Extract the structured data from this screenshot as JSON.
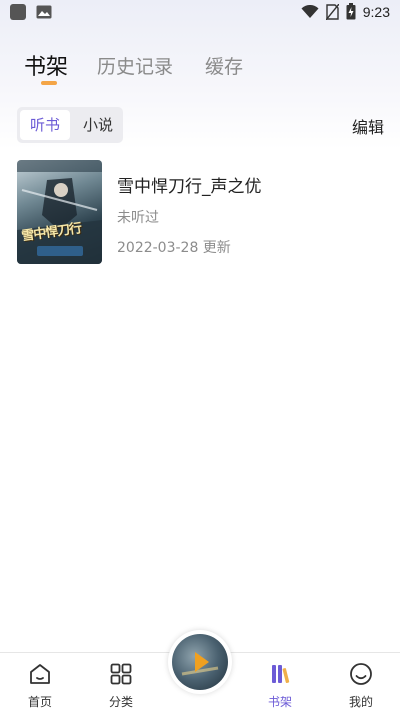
{
  "status_bar": {
    "time": "9:23",
    "icons": [
      "app-icon",
      "gallery-icon",
      "wifi-icon",
      "no-sim-icon",
      "battery-charging-icon"
    ]
  },
  "top_tabs": [
    {
      "label": "书架",
      "active": true
    },
    {
      "label": "历史记录",
      "active": false
    },
    {
      "label": "缓存",
      "active": false
    }
  ],
  "segment": {
    "items": [
      {
        "label": "听书",
        "active": true
      },
      {
        "label": "小说",
        "active": false
      }
    ]
  },
  "edit_label": "编辑",
  "books": [
    {
      "title": "雪中悍刀行_声之优",
      "status": "未听过",
      "updated": "2022-03-28 更新",
      "cover_text": "雪中悍刀行"
    }
  ],
  "bottom_nav": [
    {
      "label": "首页",
      "icon": "home-icon",
      "active": false
    },
    {
      "label": "分类",
      "icon": "category-icon",
      "active": false
    },
    {
      "label": "书架",
      "icon": "bookshelf-icon",
      "active": true
    },
    {
      "label": "我的",
      "icon": "profile-icon",
      "active": false
    }
  ],
  "player": {
    "icon": "play-icon"
  },
  "colors": {
    "accent": "#6c5bd6",
    "tab_indicator": "#f4a547",
    "play_orange": "#f0a020"
  }
}
